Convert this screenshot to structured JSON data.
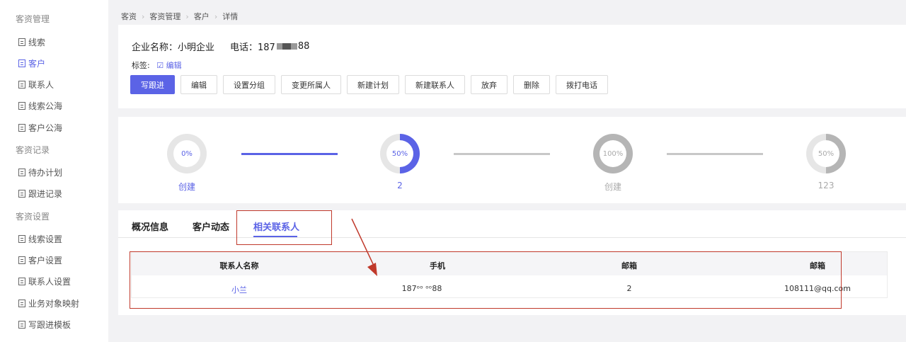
{
  "sidebar": {
    "groups": [
      "客资管理",
      "客资记录",
      "客资设置"
    ],
    "items": [
      {
        "label": "线索"
      },
      {
        "label": "客户"
      },
      {
        "label": "联系人"
      },
      {
        "label": "线索公海"
      },
      {
        "label": "客户公海"
      },
      {
        "label": "待办计划"
      },
      {
        "label": "跟进记录"
      },
      {
        "label": "线索设置"
      },
      {
        "label": "客户设置"
      },
      {
        "label": "联系人设置"
      },
      {
        "label": "业务对象映射"
      },
      {
        "label": "写跟进模板"
      }
    ],
    "active_item": "客户"
  },
  "breadcrumb": [
    "客资",
    "客资管理",
    "客户",
    "详情"
  ],
  "header": {
    "company_label": "企业名称：小明企业",
    "phone_label": "电话：187",
    "phone_suffix": "88",
    "tags_label": "标签:",
    "tags_edit": "编辑"
  },
  "actions": [
    "写跟进",
    "编辑",
    "设置分组",
    "变更所属人",
    "新建计划",
    "新建联系人",
    "放弃",
    "删除",
    "拨打电话"
  ],
  "progress": {
    "steps": [
      {
        "percent": "0%",
        "value": 0,
        "label": "创建",
        "color": "#5b63e6"
      },
      {
        "percent": "50%",
        "value": 0.5,
        "label": "2",
        "color": "#5b63e6"
      },
      {
        "percent": "100%",
        "value": 1,
        "label": "创建",
        "color": "#b5b5b5"
      },
      {
        "percent": "50%",
        "value": 0.5,
        "label": "123",
        "color": "#b5b5b5"
      }
    ]
  },
  "tabs": [
    "概况信息",
    "客户动态",
    "相关联系人"
  ],
  "active_tab": "相关联系人",
  "contacts_table": {
    "headers": [
      "联系人名称",
      "手机",
      "邮箱",
      "邮箱"
    ],
    "rows": [
      {
        "name": "小兰",
        "phone": "187ᵒᵒ ᵒᵒ88",
        "mail1": "2",
        "mail2": "108111@qq.com"
      }
    ]
  },
  "colors": {
    "accent": "#5b63e6",
    "annotation": "#c0392b"
  }
}
